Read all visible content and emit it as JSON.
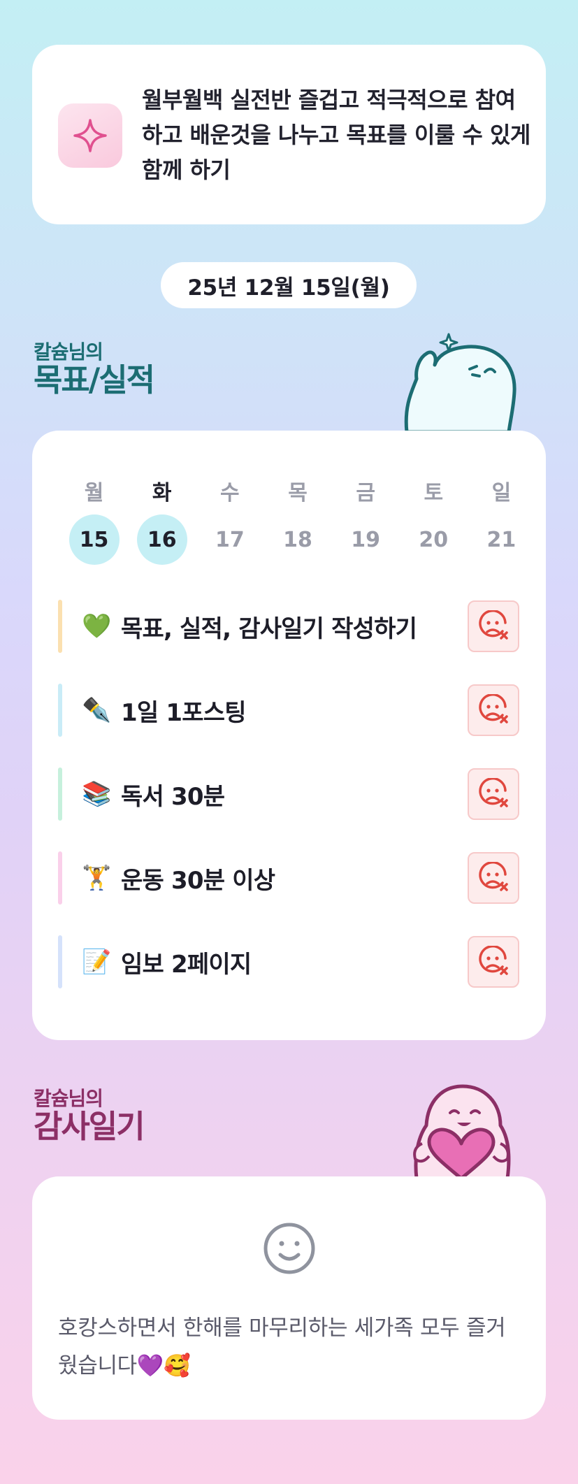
{
  "motto": {
    "icon": "sparkle-icon",
    "text": "월부월백 실전반 즐겁고 적극적으로 참여하고 배운것을 나누고 목표를 이룰 수 있게 함께 하기"
  },
  "date": "25년 12월 15일(월)",
  "goal_section": {
    "owner": "칼슘님의",
    "title": "목표/실적"
  },
  "week": {
    "days": [
      "월",
      "화",
      "수",
      "목",
      "금",
      "토",
      "일"
    ],
    "dates": [
      "15",
      "16",
      "17",
      "18",
      "19",
      "20",
      "21"
    ],
    "current_day_index": 1,
    "active_date_indices": [
      0,
      1
    ]
  },
  "tasks": [
    {
      "emoji": "💚",
      "label": "목표, 실적, 감사일기 작성하기",
      "bar_color": "#fbe0b0",
      "status_icon": "sad-face-x-icon"
    },
    {
      "emoji": "✒️",
      "label": "1일 1포스팅",
      "bar_color": "#c9ecf7",
      "status_icon": "sad-face-x-icon"
    },
    {
      "emoji": "📚",
      "label": "독서 30분",
      "bar_color": "#c6f0dc",
      "status_icon": "sad-face-x-icon"
    },
    {
      "emoji": "🏋️",
      "label": "운동 30분 이상",
      "bar_color": "#fad0ea",
      "status_icon": "sad-face-x-icon"
    },
    {
      "emoji": "📝",
      "label": "임보 2페이지",
      "bar_color": "#d5e2fb",
      "status_icon": "sad-face-x-icon"
    }
  ],
  "gratitude_section": {
    "owner": "칼슘님의",
    "title": "감사일기"
  },
  "gratitude": {
    "mood_icon": "smile-icon",
    "text": "호캉스하면서 한해를 마무리하는 세가족 모두 즐거웠습니다💜🥰"
  },
  "colors": {
    "goal_header": "#1c6d73",
    "gratitude_header": "#8c2f66",
    "active_date_bg": "#c5eff5",
    "status_bg": "#fdecec",
    "status_icon": "#e0473e"
  }
}
